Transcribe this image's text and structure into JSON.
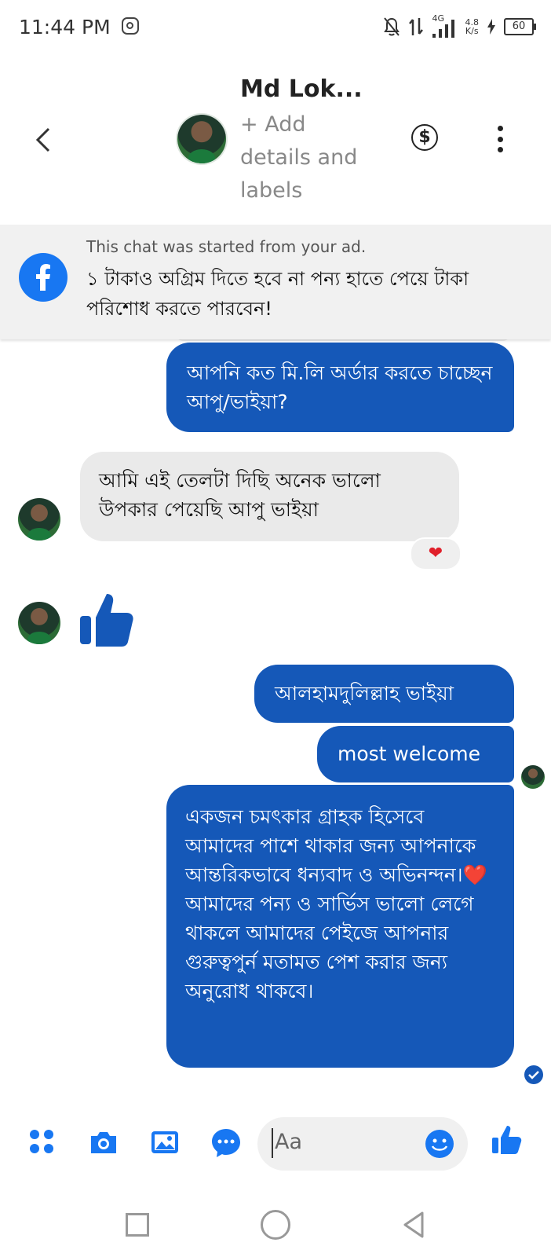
{
  "status_bar": {
    "time": "11:44 PM",
    "network": "4G",
    "speed_value": "4.8",
    "speed_unit": "K/s",
    "battery": "60",
    "icons": [
      "instagram-icon",
      "bell-off-icon",
      "data-arrows-icon",
      "signal-icon",
      "charging-icon",
      "battery-icon"
    ]
  },
  "header": {
    "name": "Md Lok...",
    "add_details": "+ Add details and labels",
    "icons": [
      "back-icon",
      "avatar",
      "dollar-icon",
      "more-icon"
    ]
  },
  "ad_banner": {
    "line1": "This chat was started from your ad.",
    "line2": "১ টাকাও অগ্রিম দিতে হবে না পন্য হাতে পেয়ে টাকা পরিশোধ করতে পারবেন!"
  },
  "messages": [
    {
      "direction": "outgoing",
      "text": "আপনি কত মি.লি অর্ডার করতে চাচ্ছেন আপু/ভাইয়া?"
    },
    {
      "direction": "incoming",
      "text": "আমি এই তেলটা দিছি অনেক ভালো উপকার পেয়েছি আপু ভাইয়া",
      "reaction": "❤"
    },
    {
      "direction": "incoming",
      "type": "thumbs-up-sticker"
    },
    {
      "direction": "outgoing",
      "text": "আলহামদুলিল্লাহ ভাইয়া"
    },
    {
      "direction": "outgoing",
      "text": "most welcome"
    },
    {
      "direction": "outgoing",
      "text": "একজন  চমৎকার গ্রাহক হিসেবে আমাদের পাশে থাকার জন্য আপনাকে আন্তরিকভাবে ধন্যবাদ ও অভিনন্দন।❤️ আমাদের পন্য ও সার্ভিস ভালো লেগে থাকলে আমাদের পেইজে আপনার গুরুত্বপুর্ন মতামত পেশ করার জন্য অনুরোধ থাকবে।"
    }
  ],
  "composer": {
    "placeholder": "Aa",
    "icons": [
      "apps-icon",
      "camera-icon",
      "gallery-icon",
      "chat-icon",
      "emoji-icon",
      "thumbs-up-icon"
    ]
  },
  "colors": {
    "outgoing_bubble": "#1558b8",
    "incoming_bubble": "#eaeaea",
    "accent": "#1877f2",
    "reaction_heart": "#e0202b"
  }
}
